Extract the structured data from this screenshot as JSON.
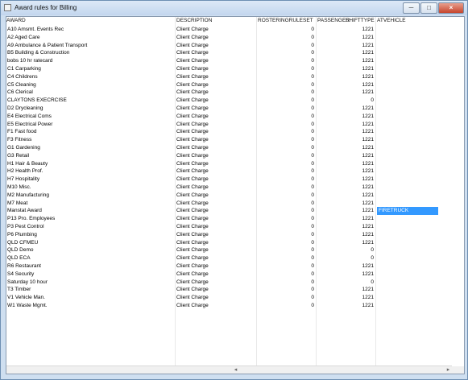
{
  "window": {
    "title": "Award rules for Billing",
    "minimize": "─",
    "maximize": "□",
    "close": "×"
  },
  "columns": {
    "award": "AWARD",
    "description": "DESCRIPTION",
    "rostering": "ROSTERINGRULESET",
    "passenger": "PASSENGER",
    "shifttype": "SHIFTTYPE",
    "atvehicle": "ATVEHICLE"
  },
  "rows": [
    {
      "award": "A10 Amsmt. Events Rec",
      "description": "Client Charge",
      "rostering": "0",
      "shifttype": "1221",
      "atvehicle": ""
    },
    {
      "award": "A2 Aged Care",
      "description": "Client Charge",
      "rostering": "0",
      "shifttype": "1221",
      "atvehicle": ""
    },
    {
      "award": "A9 Ambulance & Patient Transport",
      "description": "Client Charge",
      "rostering": "0",
      "shifttype": "1221",
      "atvehicle": ""
    },
    {
      "award": "B5 Building & Construction",
      "description": "Client Charge",
      "rostering": "0",
      "shifttype": "1221",
      "atvehicle": ""
    },
    {
      "award": "bobs 10 hr ratecard",
      "description": "Client Charge",
      "rostering": "0",
      "shifttype": "1221",
      "atvehicle": ""
    },
    {
      "award": "C1 Carparking",
      "description": "Client Charge",
      "rostering": "0",
      "shifttype": "1221",
      "atvehicle": ""
    },
    {
      "award": "C4 Childrens",
      "description": "Client Charge",
      "rostering": "0",
      "shifttype": "1221",
      "atvehicle": ""
    },
    {
      "award": "C5 Cleaning",
      "description": "Client Charge",
      "rostering": "0",
      "shifttype": "1221",
      "atvehicle": ""
    },
    {
      "award": "C6 Clerical",
      "description": "Client Charge",
      "rostering": "0",
      "shifttype": "1221",
      "atvehicle": ""
    },
    {
      "award": "CLAYTONS EXECRCISE",
      "description": "Client Charge",
      "rostering": "0",
      "shifttype": "0",
      "atvehicle": ""
    },
    {
      "award": "D2 Drycleaning",
      "description": "Client Charge",
      "rostering": "0",
      "shifttype": "1221",
      "atvehicle": ""
    },
    {
      "award": "E4 Electrical Coms",
      "description": "Client Charge",
      "rostering": "0",
      "shifttype": "1221",
      "atvehicle": ""
    },
    {
      "award": "E5 Electrical Power",
      "description": "Client Charge",
      "rostering": "0",
      "shifttype": "1221",
      "atvehicle": ""
    },
    {
      "award": "F1 Fast food",
      "description": "Client Charge",
      "rostering": "0",
      "shifttype": "1221",
      "atvehicle": ""
    },
    {
      "award": "F3 Fitness",
      "description": "Client Charge",
      "rostering": "0",
      "shifttype": "1221",
      "atvehicle": ""
    },
    {
      "award": "G1 Gardening",
      "description": "Client Charge",
      "rostering": "0",
      "shifttype": "1221",
      "atvehicle": ""
    },
    {
      "award": "G3 Retail",
      "description": "Client Charge",
      "rostering": "0",
      "shifttype": "1221",
      "atvehicle": ""
    },
    {
      "award": "H1 Hair & Beauty",
      "description": "Client Charge",
      "rostering": "0",
      "shifttype": "1221",
      "atvehicle": ""
    },
    {
      "award": "H2 Health Prof.",
      "description": "Client Charge",
      "rostering": "0",
      "shifttype": "1221",
      "atvehicle": ""
    },
    {
      "award": "H7 Hospitality",
      "description": "Client Charge",
      "rostering": "0",
      "shifttype": "1221",
      "atvehicle": ""
    },
    {
      "award": "M10 Misc.",
      "description": "Client Charge",
      "rostering": "0",
      "shifttype": "1221",
      "atvehicle": ""
    },
    {
      "award": "M2 Manufacturing",
      "description": "Client Charge",
      "rostering": "0",
      "shifttype": "1221",
      "atvehicle": ""
    },
    {
      "award": "M7 Meat",
      "description": "Client Charge",
      "rostering": "0",
      "shifttype": "1221",
      "atvehicle": ""
    },
    {
      "award": "Manstat Award",
      "description": "Client Charge",
      "rostering": "0",
      "shifttype": "1221",
      "atvehicle": "FIRETRUCK"
    },
    {
      "award": "P13 Pro. Employees",
      "description": "Client Charge",
      "rostering": "0",
      "shifttype": "1221",
      "atvehicle": ""
    },
    {
      "award": "P3 Pest Control",
      "description": "Client Charge",
      "rostering": "0",
      "shifttype": "1221",
      "atvehicle": ""
    },
    {
      "award": "P6 Plumbing",
      "description": "Client Charge",
      "rostering": "0",
      "shifttype": "1221",
      "atvehicle": ""
    },
    {
      "award": "QLD CFMEU",
      "description": "Client Charge",
      "rostering": "0",
      "shifttype": "1221",
      "atvehicle": ""
    },
    {
      "award": "QLD Demo",
      "description": "Client Charge",
      "rostering": "0",
      "shifttype": "0",
      "atvehicle": ""
    },
    {
      "award": "QLD ECA",
      "description": "Client Charge",
      "rostering": "0",
      "shifttype": "0",
      "atvehicle": ""
    },
    {
      "award": "R6 Restaurant",
      "description": "Client Charge",
      "rostering": "0",
      "shifttype": "1221",
      "atvehicle": ""
    },
    {
      "award": "S4 Security",
      "description": "Client Charge",
      "rostering": "0",
      "shifttype": "1221",
      "atvehicle": ""
    },
    {
      "award": "Saturday 10 hour",
      "description": "Client Charge",
      "rostering": "0",
      "shifttype": "0",
      "atvehicle": ""
    },
    {
      "award": "T3 Timber",
      "description": "Client Charge",
      "rostering": "0",
      "shifttype": "1221",
      "atvehicle": ""
    },
    {
      "award": "V1 Vehicle Man.",
      "description": "Client Charge",
      "rostering": "0",
      "shifttype": "1221",
      "atvehicle": ""
    },
    {
      "award": "W1 Waste Mgmt.",
      "description": "Client Charge",
      "rostering": "0",
      "shifttype": "1221",
      "atvehicle": ""
    }
  ],
  "scrollbar": {
    "left_arrow": "◂",
    "right_arrow": "▸"
  },
  "colors": {
    "selection": "#3399ff"
  }
}
